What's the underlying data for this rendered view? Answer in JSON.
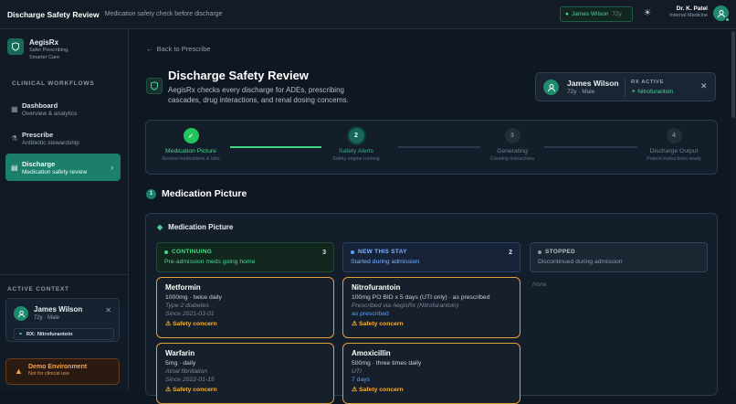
{
  "header": {
    "title": "Discharge Safety Review",
    "subtitle": "Medication safety check before discharge",
    "patient_chip": {
      "name": "James Wilson",
      "age": "72y"
    },
    "user": {
      "name": "Dr. K. Patel",
      "role": "Internal Medicine"
    }
  },
  "sidebar": {
    "brand": {
      "name": "AegisRx",
      "tagline1": "Safer Prescribing,",
      "tagline2": "Smarter Care"
    },
    "section_label": "CLINICAL WORKFLOWS",
    "items": [
      {
        "label": "Dashboard",
        "sub": "Overview & analytics"
      },
      {
        "label": "Prescribe",
        "sub": "Antibiotic stewardship"
      },
      {
        "label": "Discharge",
        "sub": "Medication safety review"
      }
    ],
    "context_label": "ACTIVE CONTEXT",
    "context": {
      "name": "James Wilson",
      "age": "72y · Male",
      "rx_label": "RX:",
      "rx_value": "Nitrofurantoin"
    },
    "demo": {
      "title": "Demo Environment",
      "sub": "Not for clinical use"
    }
  },
  "main": {
    "back": "Back to Prescribe",
    "title": "Discharge Safety Review",
    "description": "AegisRx checks every discharge for ADEs, prescribing cascades, drug interactions, and renal dosing concerns.",
    "patient_card": {
      "name": "James Wilson",
      "age": "72y · Male",
      "rx_label": "RX ACTIVE",
      "rx_value": "Nitrofurantoin"
    },
    "steps": [
      {
        "num": "✓",
        "label": "Medication Picture",
        "sub": "Review medications & labs"
      },
      {
        "num": "2",
        "label": "Safety Alerts",
        "sub": "Safety engine running"
      },
      {
        "num": "3",
        "label": "Generating",
        "sub": "Creating instructions"
      },
      {
        "num": "4",
        "label": "Discharge Output",
        "sub": "Patient instructions ready"
      }
    ],
    "section": {
      "num": "1",
      "title": "Medication Picture"
    },
    "panel_title": "Medication Picture",
    "columns": [
      {
        "title": "CONTINUING",
        "sub": "Pre-admission meds going home",
        "count": "3",
        "meds": [
          {
            "name": "Metformin",
            "dose": "1000mg · twice daily",
            "info1": "Type 2 diabetes",
            "info2": "Since 2021-03-01",
            "warn": "Safety concern"
          },
          {
            "name": "Warfarin",
            "dose": "5mg · daily",
            "info1": "Atrial fibrillation",
            "info2": "Since 2022-01-15",
            "warn": "Safety concern"
          }
        ]
      },
      {
        "title": "NEW THIS STAY",
        "sub": "Started during admission",
        "count": "2",
        "meds": [
          {
            "name": "Nitrofurantoin",
            "dose": "100mg PO BID x 5 days (UTI only) · as prescribed",
            "info1": "Prescribed via AegisRx (Nitrofurantoin)",
            "info2": "as prescribed",
            "warn": "Safety concern"
          },
          {
            "name": "Amoxicillin",
            "dose": "500mg · three times daily",
            "info1": "UTI",
            "info2": "7 days",
            "warn": "Safety concern"
          }
        ]
      },
      {
        "title": "STOPPED",
        "sub": "Discontinued during admission",
        "none": "None"
      }
    ]
  },
  "colors": {
    "accent": "#1b7f6c",
    "green": "#3ddc84",
    "warning": "#e0a33a",
    "blue": "#5aa0ff"
  }
}
